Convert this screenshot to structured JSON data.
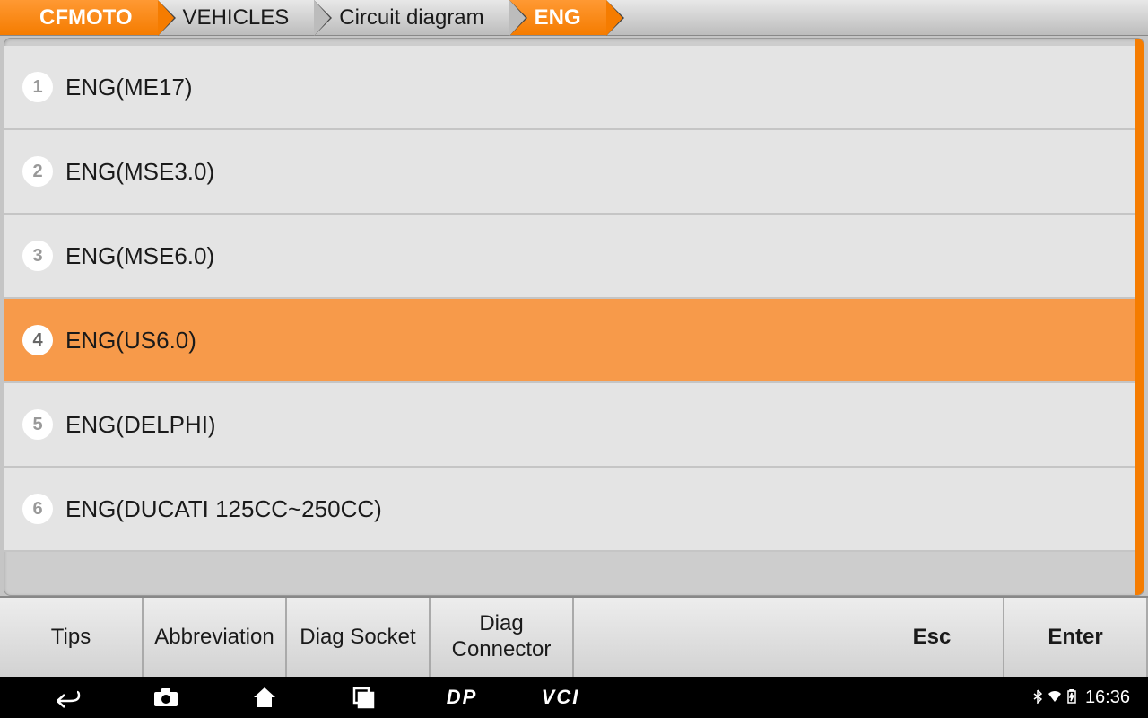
{
  "breadcrumb": [
    {
      "label": "CFMOTO",
      "active": true
    },
    {
      "label": "VEHICLES",
      "active": false
    },
    {
      "label": "Circuit diagram",
      "active": false
    },
    {
      "label": "ENG",
      "active": true
    }
  ],
  "list_items": [
    {
      "num": "1",
      "label": "ENG(ME17)",
      "selected": false
    },
    {
      "num": "2",
      "label": "ENG(MSE3.0)",
      "selected": false
    },
    {
      "num": "3",
      "label": "ENG(MSE6.0)",
      "selected": false
    },
    {
      "num": "4",
      "label": "ENG(US6.0)",
      "selected": true
    },
    {
      "num": "5",
      "label": "ENG(DELPHI)",
      "selected": false
    },
    {
      "num": "6",
      "label": "ENG(DUCATI 125CC~250CC)",
      "selected": false
    }
  ],
  "buttons": {
    "tips": "Tips",
    "abbr": "Abbreviation",
    "socket": "Diag Socket",
    "connector": "Diag Connector",
    "esc": "Esc",
    "enter": "Enter"
  },
  "navbar": {
    "dp": "DP",
    "vci": "VCI"
  },
  "status": {
    "time": "16:36"
  }
}
